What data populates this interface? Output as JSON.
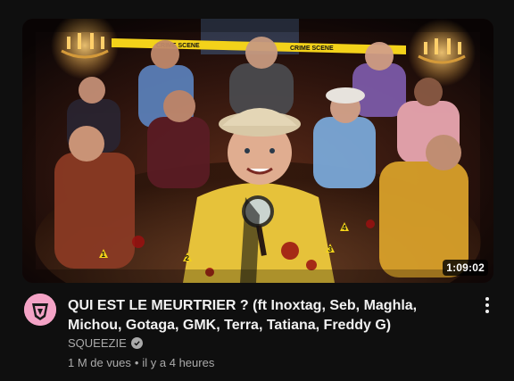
{
  "video": {
    "title": "QUI EST LE MEURTRIER ? (ft Inoxtag, Seb, Maghla, Michou, Gotaga, GMK, Terra, Tatiana, Freddy G)",
    "duration": "1:09:02",
    "channel": "SQUEEZIE",
    "views": "1 M de vues",
    "separator": "•",
    "age": "il y a 4 heures"
  },
  "thumbnail": {
    "tape_text": "CRIME SCENE",
    "evidence_markers": [
      "1",
      "2",
      "3",
      "4"
    ]
  },
  "icons": {
    "verified": "check-circle-icon",
    "menu": "more-vertical-icon",
    "avatar": "channel-logo"
  },
  "colors": {
    "background": "#0f0f0f",
    "title": "#f1f1f1",
    "secondary": "#aaaaaa",
    "avatar_bg": "#f4a3c6"
  }
}
